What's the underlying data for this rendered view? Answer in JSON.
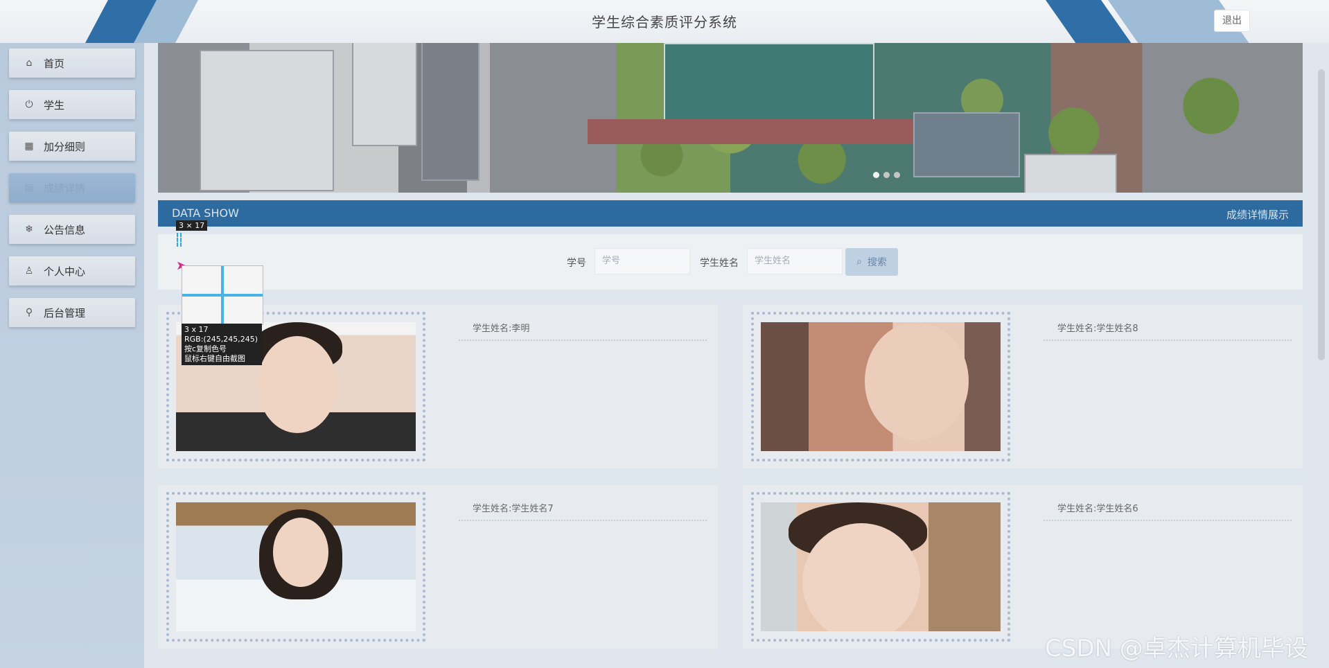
{
  "header": {
    "title": "学生综合素质评分系统",
    "logout_label": "退出"
  },
  "sidebar": {
    "items": [
      {
        "label": "首页",
        "icon": "home-icon",
        "glyph": "⌂"
      },
      {
        "label": "学生",
        "icon": "power-icon",
        "glyph": "⏻"
      },
      {
        "label": "加分细则",
        "icon": "grid-icon",
        "glyph": "▦"
      },
      {
        "label": "成绩详情",
        "icon": "document-icon",
        "glyph": "▤",
        "active": true
      },
      {
        "label": "公告信息",
        "icon": "snowflake-icon",
        "glyph": "❄"
      },
      {
        "label": "个人中心",
        "icon": "user-icon",
        "glyph": "♙"
      },
      {
        "label": "后台管理",
        "icon": "link-icon",
        "glyph": "⚲"
      }
    ]
  },
  "banner": {
    "slides": 3,
    "active_slide": 1
  },
  "section": {
    "left_title": "DATA SHOW",
    "right_title": "成绩详情展示"
  },
  "search": {
    "student_id_label": "学号",
    "student_id_placeholder": "学号",
    "student_name_label": "学生姓名",
    "student_name_placeholder": "学生姓名",
    "button_label": "搜索"
  },
  "cards": [
    {
      "name_text": "学生姓名:李明"
    },
    {
      "name_text": "学生姓名:学生姓名8"
    },
    {
      "name_text": "学生姓名:学生姓名7"
    },
    {
      "name_text": "学生姓名:学生姓名6"
    }
  ],
  "screenshot_tool": {
    "size_label": "3 × 17",
    "info_size": "3 x 17",
    "info_rgb": "RGB:(245,245,245)",
    "info_copy": "按c复制色号",
    "info_capture": "鼠标右键自由截图"
  },
  "watermark": "CSDN @卓杰计算机毕设",
  "colors": {
    "accent": "#2c6aa0",
    "sidebar": "#b9cadd"
  }
}
